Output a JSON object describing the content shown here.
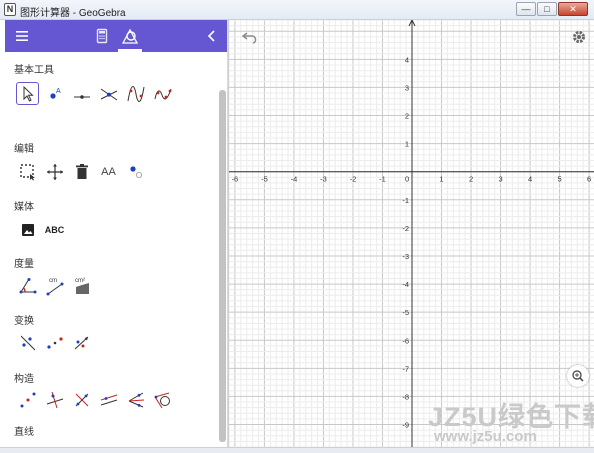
{
  "window": {
    "logo_glyph": "N",
    "title": "图形计算器 - GeoGebra",
    "buttons": {
      "minimize": "—",
      "maximize": "□",
      "close": "✕"
    }
  },
  "panel": {
    "header": {
      "menu_icon": "menu-icon",
      "calculator_icon": "calculator-icon",
      "tools_icon": "tools-icon",
      "collapse_icon": "chevron-left-icon",
      "active_tab": "tools",
      "accent_color": "#6557d2"
    },
    "categories": [
      {
        "label": "基本工具",
        "tools": [
          "move",
          "point",
          "slider a=2",
          "intersect",
          "function",
          "freehand"
        ]
      },
      {
        "label": "编辑",
        "tools": [
          "select",
          "move-graphics",
          "delete",
          "text-style",
          "show-hide"
        ]
      },
      {
        "label": "媒体",
        "tools": [
          "image",
          "text"
        ]
      },
      {
        "label": "度量",
        "tools": [
          "angle",
          "distance cm",
          "area cm²"
        ]
      },
      {
        "label": "变换",
        "tools": [
          "reflect-line",
          "reflect-point",
          "translate-vector"
        ]
      },
      {
        "label": "构造",
        "tools": [
          "midpoint",
          "perpendicular",
          "perpendicular-bisector",
          "parallel",
          "angle-bisector",
          "tangents"
        ]
      },
      {
        "label": "直线",
        "tools": [
          "segment",
          "line",
          "ray",
          "vector"
        ]
      }
    ],
    "tool_texts": {
      "slider_label": "a = 2",
      "text_style": "AA",
      "text_tool": "ABC",
      "distance_unit": "cm",
      "area_unit": "cm²"
    }
  },
  "graphics": {
    "undo_icon": "undo-icon",
    "settings_icon": "gear-icon",
    "zoom_in_icon": "zoom-in-icon",
    "x_ticks": [
      "-6",
      "-5",
      "-4",
      "-3",
      "-2",
      "-1",
      "0",
      "1",
      "2",
      "3",
      "4",
      "5",
      "6"
    ],
    "y_ticks": [
      "4",
      "3",
      "2",
      "1",
      "-1",
      "-2",
      "-3",
      "-4",
      "-5",
      "-6",
      "-7",
      "-8",
      "-9"
    ],
    "xlim": [
      -6.2,
      6.2
    ],
    "ylim": [
      -9.8,
      5.4
    ],
    "grid": true
  },
  "watermark": {
    "brand": "JZ5U绿色下载",
    "url": "www.jz5u.com"
  }
}
